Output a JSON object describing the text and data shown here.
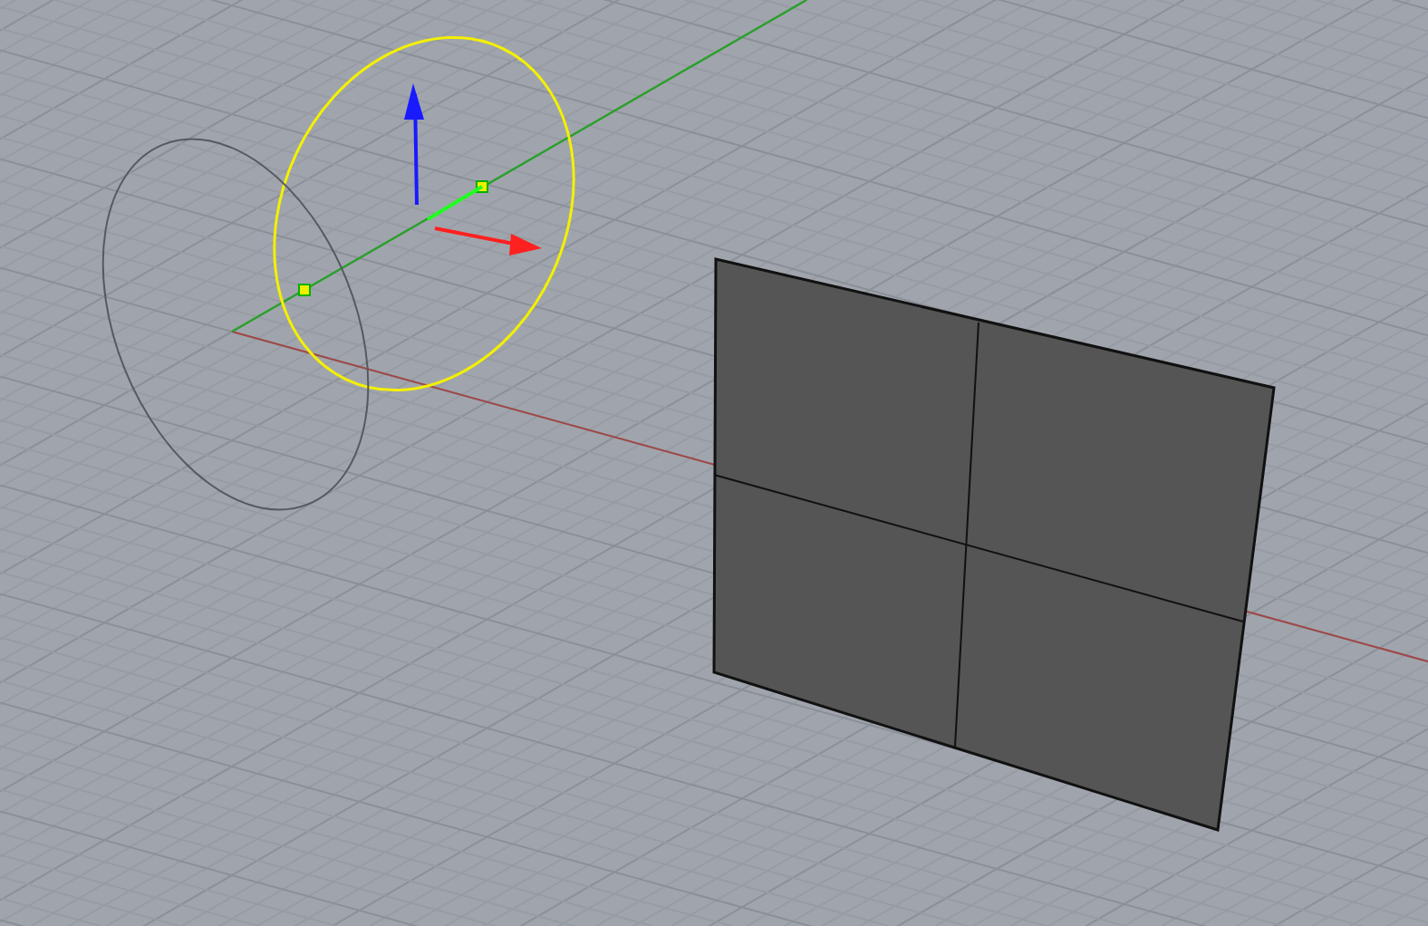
{
  "viewport": {
    "objects": [
      {
        "kind": "circle",
        "selected": true
      },
      {
        "kind": "circle",
        "selected": false
      },
      {
        "kind": "surface",
        "selected": false
      }
    ]
  }
}
